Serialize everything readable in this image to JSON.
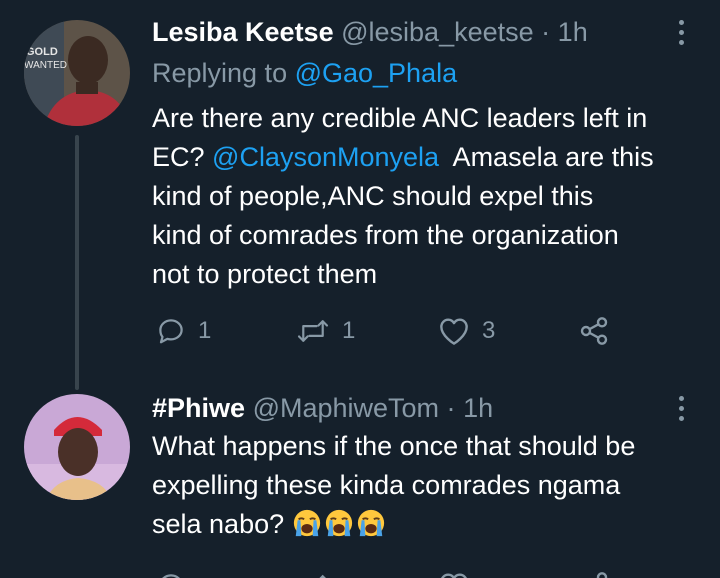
{
  "tweets": [
    {
      "display_name": "Lesiba Keetse",
      "handle": "@lesiba_keetse",
      "separator": "·",
      "time": "1h",
      "replying_prefix": "Replying to ",
      "replying_to": "@Gao_Phala",
      "text_line_1": "Are there any credible ANC leaders left in",
      "text_line_2_pre": "EC? ",
      "mention": "@ClaysonMonyela",
      "text_line_2_post": "  Amasela are this",
      "text_line_3": "kind of people,ANC should expel this",
      "text_line_4": "kind of comrades from the organization",
      "text_line_5": "not to protect them",
      "reply_count": "1",
      "retweet_count": "1",
      "like_count": "3",
      "avatar_text": "GOLD WANTED",
      "colors": {
        "avatar_bg": "#6b5a4a",
        "shirt": "#b0303b"
      }
    },
    {
      "display_name": "#Phiwe",
      "handle": "@MaphiweTom",
      "separator": "·",
      "time": "1h",
      "text_line_1": "What happens if the once that should be",
      "text_line_2": "expelling these kinda comrades ngama",
      "text_line_3": "sela nabo?",
      "emoji_icons": [
        "loudly-crying-face-icon",
        "loudly-crying-face-icon",
        "loudly-crying-face-icon"
      ],
      "colors": {
        "avatar_bg": "#c9a8d6",
        "cap": "#d42a3a"
      }
    }
  ],
  "theme": {
    "background": "#15202b",
    "secondary_text": "#8899a6",
    "link": "#1da1f2",
    "thread_line": "#38444d"
  }
}
